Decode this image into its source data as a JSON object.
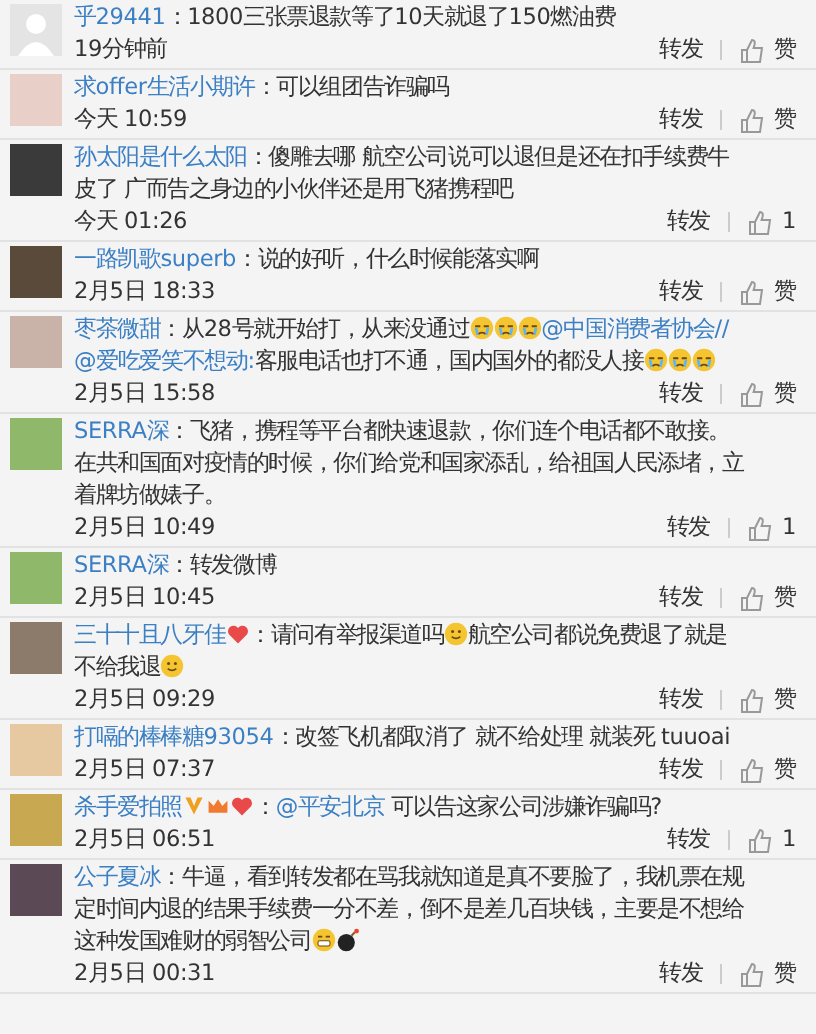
{
  "comments": [
    {
      "user": "乎29441",
      "separator": "：",
      "segments": [
        {
          "kind": "text",
          "text": "1800三张票退款等了10天就退了150燃油费"
        }
      ],
      "time": "19分钟前",
      "repost": "转发",
      "like": "赞"
    },
    {
      "user": "求offer生活小期许",
      "separator": "：",
      "segments": [
        {
          "kind": "text",
          "text": "可以组团告诈骗吗"
        }
      ],
      "time": "今天 10:59",
      "repost": "转发",
      "like": "赞"
    },
    {
      "user": "孙太阳是什么太阳",
      "separator": "：",
      "segments": [
        {
          "kind": "text",
          "text": "傻雕去哪 航空公司说可以退但是还在扣手续费牛皮了 广而告之身边的小伙伴还是用飞猪携程吧"
        }
      ],
      "time": "今天 01:26",
      "repost": "转发",
      "like": "1"
    },
    {
      "user": "一路凯歌superb",
      "separator": "：",
      "segments": [
        {
          "kind": "text",
          "text": "说的好听，什么时候能落实啊"
        }
      ],
      "time": "2月5日 18:33",
      "repost": "转发",
      "like": "赞"
    },
    {
      "user": "枣茶微甜",
      "separator": "：",
      "segments": [
        {
          "kind": "text",
          "text": "从28号就开始打，从来没通过"
        },
        {
          "kind": "cry"
        },
        {
          "kind": "cry"
        },
        {
          "kind": "cry"
        },
        {
          "kind": "mention",
          "text": "@中国消费者协会"
        },
        {
          "kind": "mention",
          "text": "//@爱吃爱笑不想动:"
        },
        {
          "kind": "text",
          "text": "客服电话也打不通，国内国外的都没人接"
        },
        {
          "kind": "cry"
        },
        {
          "kind": "cry"
        },
        {
          "kind": "cry"
        }
      ],
      "time": "2月5日 15:58",
      "repost": "转发",
      "like": "赞"
    },
    {
      "user": "SERRA深",
      "separator": "：",
      "segments": [
        {
          "kind": "text",
          "text": "飞猪，携程等平台都快速退款，你们连个电话都不敢接。在共和国面对疫情的时候，你们给党和国家添乱，给祖国人民添堵，立着牌坊做婊子。"
        }
      ],
      "time": "2月5日 10:49",
      "repost": "转发",
      "like": "1"
    },
    {
      "user": "SERRA深",
      "separator": "：",
      "segments": [
        {
          "kind": "text",
          "text": "转发微博"
        }
      ],
      "time": "2月5日 10:45",
      "repost": "转发",
      "like": "赞"
    },
    {
      "user": "三十十且八牙佳",
      "separator": "：",
      "badges": [
        {
          "kind": "heart"
        }
      ],
      "segments": [
        {
          "kind": "text",
          "text": "请问有举报渠道吗"
        },
        {
          "kind": "smile"
        },
        {
          "kind": "text",
          "text": "航空公司都说免费退了就是不给我退"
        },
        {
          "kind": "smile"
        }
      ],
      "time": "2月5日 09:29",
      "repost": "转发",
      "like": "赞"
    },
    {
      "user": "打嗝的棒棒糖93054",
      "separator": "：",
      "segments": [
        {
          "kind": "text",
          "text": "改签飞机都取消了 就不给处理 就装死 tuuoai"
        }
      ],
      "time": "2月5日 07:37",
      "repost": "转发",
      "like": "赞"
    },
    {
      "user": "杀手爱拍照",
      "separator": "：",
      "badges": [
        {
          "kind": "vip"
        },
        {
          "kind": "crown"
        },
        {
          "kind": "heart"
        }
      ],
      "segments": [
        {
          "kind": "mention",
          "text": "@平安北京"
        },
        {
          "kind": "text",
          "text": " 可以告这家公司涉嫌诈骗吗?"
        }
      ],
      "time": "2月5日 06:51",
      "repost": "转发",
      "like": "1"
    },
    {
      "user": "公子夏冰",
      "separator": "：",
      "segments": [
        {
          "kind": "text",
          "text": "牛逼，看到转发都在骂我就知道是真不要脸了，我机票在规定时间内退的结果手续费一分不差，倒不是差几百块钱，主要是不想给这种发国难财的弱智公司"
        },
        {
          "kind": "grin"
        },
        {
          "kind": "bomb"
        }
      ],
      "time": "2月5日 00:31",
      "repost": "转发",
      "like": "赞"
    }
  ]
}
